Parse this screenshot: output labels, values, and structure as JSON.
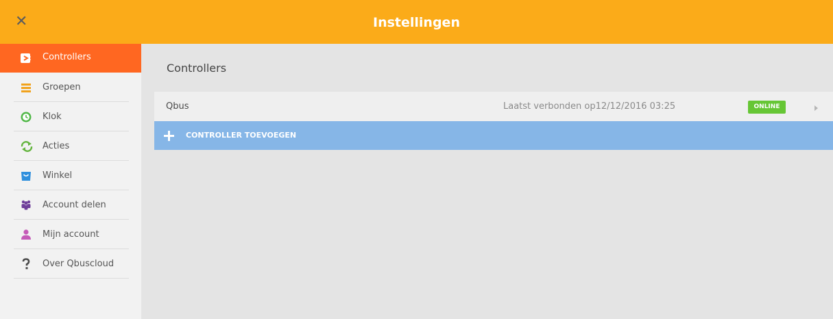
{
  "header": {
    "title": "Instellingen",
    "close_icon": "close-icon"
  },
  "sidebar": {
    "items": [
      {
        "label": "Controllers",
        "icon": "controller-icon",
        "active": true
      },
      {
        "label": "Groepen",
        "icon": "groups-icon"
      },
      {
        "label": "Klok",
        "icon": "clock-icon"
      },
      {
        "label": "Acties",
        "icon": "refresh-icon"
      },
      {
        "label": "Winkel",
        "icon": "shop-icon"
      },
      {
        "label": "Account delen",
        "icon": "users-icon"
      },
      {
        "label": "Mijn account",
        "icon": "user-icon"
      },
      {
        "label": "Over Qbuscloud",
        "icon": "question-icon"
      }
    ]
  },
  "main": {
    "title": "Controllers",
    "controllers": [
      {
        "name": "Qbus",
        "last_connected": "Laatst verbonden op12/12/2016 03:25",
        "status": "ONLINE"
      }
    ],
    "add_label": "CONTROLLER TOEVOEGEN"
  },
  "colors": {
    "header": "#fbab19",
    "active": "#ff6721",
    "online": "#66c635",
    "add": "#86b6e7"
  }
}
